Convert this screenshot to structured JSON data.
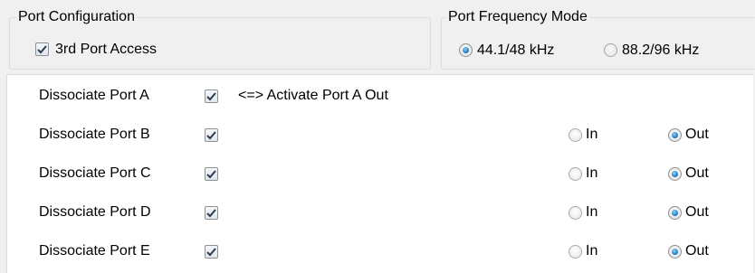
{
  "port_configuration": {
    "title": "Port Configuration",
    "third_port_access": {
      "label": "3rd Port Access",
      "checked": true
    }
  },
  "port_frequency_mode": {
    "title": "Port Frequency Mode",
    "options": [
      {
        "label": "44.1/48 kHz",
        "selected": true
      },
      {
        "label": "88.2/96 kHz",
        "selected": false
      }
    ]
  },
  "ports": [
    {
      "label": "Dissociate Port A",
      "checked": true,
      "activate_label": "<=> Activate Port A Out"
    },
    {
      "label": "Dissociate Port B",
      "checked": true,
      "in_label": "In",
      "out_label": "Out",
      "direction": "Out"
    },
    {
      "label": "Dissociate Port C",
      "checked": true,
      "in_label": "In",
      "out_label": "Out",
      "direction": "Out"
    },
    {
      "label": "Dissociate Port D",
      "checked": true,
      "in_label": "In",
      "out_label": "Out",
      "direction": "Out"
    },
    {
      "label": "Dissociate Port E",
      "checked": true,
      "in_label": "In",
      "out_label": "Out",
      "direction": "Out"
    }
  ],
  "colors": {
    "radio_accent": "#1a6fb5",
    "check_mark": "#2e3b4e",
    "groupbox_border": "#d5dfe5"
  }
}
